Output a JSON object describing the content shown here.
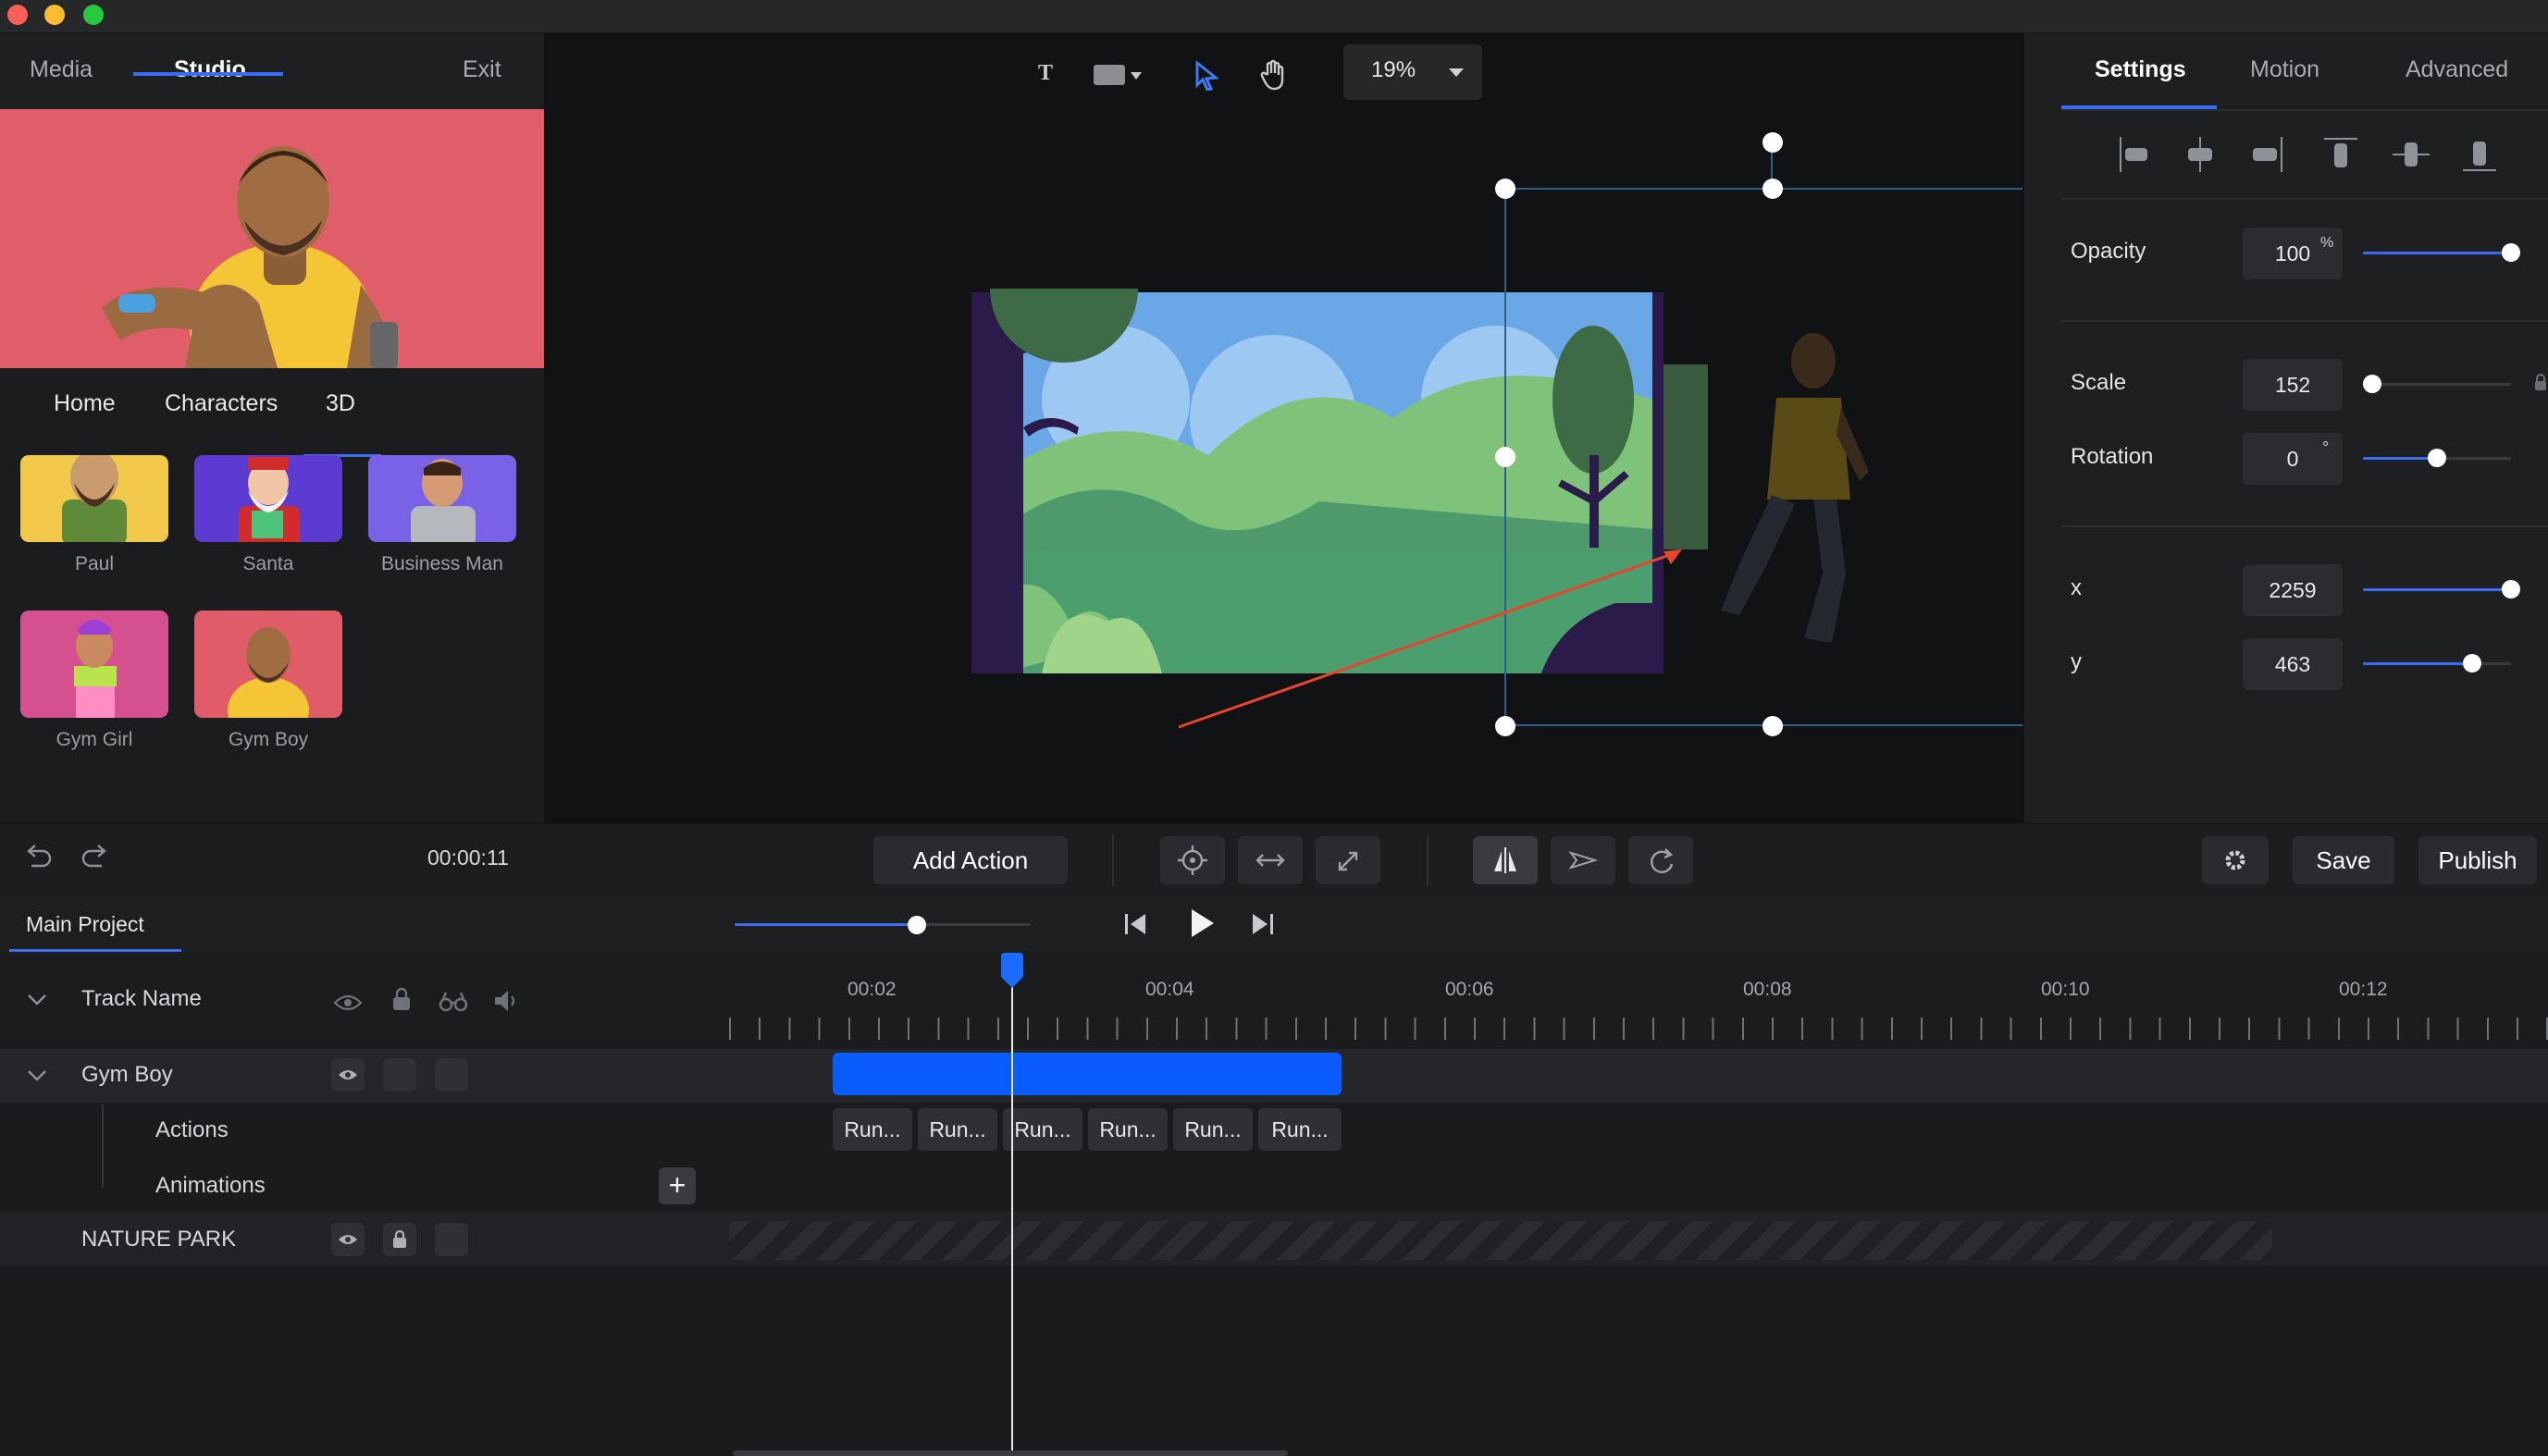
{
  "left_panel": {
    "tabs": [
      "Media",
      "Studio"
    ],
    "exit_label": "Exit",
    "sub_tabs": [
      "Home",
      "Characters",
      "3D"
    ],
    "characters": [
      {
        "name": "Paul",
        "bg": "#f2c84a"
      },
      {
        "name": "Santa",
        "bg": "#5b3bd1"
      },
      {
        "name": "Business Man",
        "bg": "#7a62e6"
      },
      {
        "name": "Gym Girl",
        "bg": "#d4508e"
      },
      {
        "name": "Gym Boy",
        "bg": "#df5c68"
      }
    ]
  },
  "canvas_toolbar": {
    "zoom": "19%"
  },
  "right_panel": {
    "tabs": [
      "Settings",
      "Motion",
      "Advanced"
    ],
    "opacity": {
      "label": "Opacity",
      "value": "100",
      "unit": "%",
      "level": 1.0
    },
    "scale": {
      "label": "Scale",
      "value": "152",
      "level": 0.0
    },
    "rotation": {
      "label": "Rotation",
      "value": "0",
      "unit": "°",
      "level": 0.5
    },
    "x": {
      "label": "x",
      "value": "2259",
      "level": 1.0
    },
    "y": {
      "label": "y",
      "value": "463",
      "level": 0.73
    }
  },
  "toolbar": {
    "time": "00:00:11",
    "add_action": "Add Action",
    "save": "Save",
    "publish": "Publish"
  },
  "timeline": {
    "project_tab": "Main Project",
    "track_header": "Track Name",
    "ruler": [
      "00:02",
      "00:04",
      "00:06",
      "00:08",
      "00:10",
      "00:12"
    ],
    "tracks": {
      "gym_boy": "Gym Boy",
      "actions": "Actions",
      "animations": "Animations",
      "nature_park": "NATURE PARK"
    },
    "action_clips": [
      "Run...",
      "Run...",
      "Run...",
      "Run...",
      "Run...",
      "Run..."
    ]
  },
  "colors": {
    "accent": "#3d6bf6",
    "preview_bg": "#e05d6a",
    "clip_bar": "#0a5cff"
  }
}
